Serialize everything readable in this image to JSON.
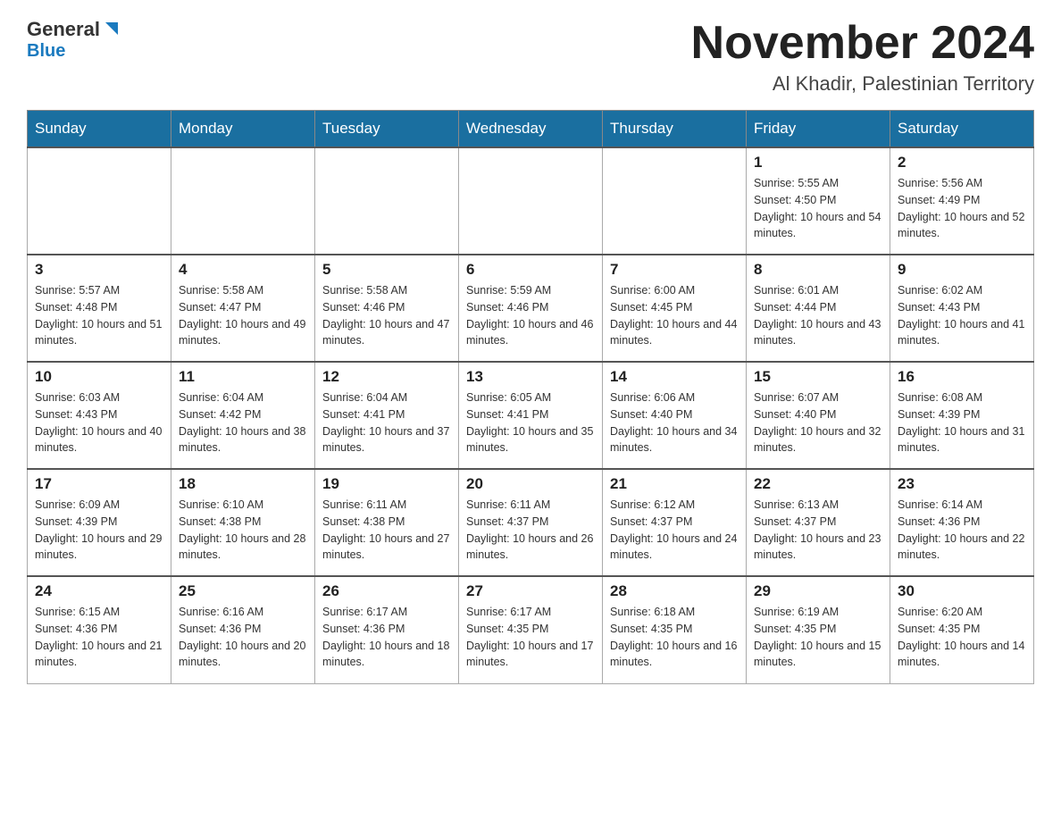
{
  "header": {
    "logo_general": "General",
    "logo_blue": "Blue",
    "title": "November 2024",
    "subtitle": "Al Khadir, Palestinian Territory"
  },
  "days_of_week": [
    "Sunday",
    "Monday",
    "Tuesday",
    "Wednesday",
    "Thursday",
    "Friday",
    "Saturday"
  ],
  "weeks": [
    {
      "days": [
        {
          "number": "",
          "empty": true
        },
        {
          "number": "",
          "empty": true
        },
        {
          "number": "",
          "empty": true
        },
        {
          "number": "",
          "empty": true
        },
        {
          "number": "",
          "empty": true
        },
        {
          "number": "1",
          "sunrise": "Sunrise: 5:55 AM",
          "sunset": "Sunset: 4:50 PM",
          "daylight": "Daylight: 10 hours and 54 minutes."
        },
        {
          "number": "2",
          "sunrise": "Sunrise: 5:56 AM",
          "sunset": "Sunset: 4:49 PM",
          "daylight": "Daylight: 10 hours and 52 minutes."
        }
      ]
    },
    {
      "days": [
        {
          "number": "3",
          "sunrise": "Sunrise: 5:57 AM",
          "sunset": "Sunset: 4:48 PM",
          "daylight": "Daylight: 10 hours and 51 minutes."
        },
        {
          "number": "4",
          "sunrise": "Sunrise: 5:58 AM",
          "sunset": "Sunset: 4:47 PM",
          "daylight": "Daylight: 10 hours and 49 minutes."
        },
        {
          "number": "5",
          "sunrise": "Sunrise: 5:58 AM",
          "sunset": "Sunset: 4:46 PM",
          "daylight": "Daylight: 10 hours and 47 minutes."
        },
        {
          "number": "6",
          "sunrise": "Sunrise: 5:59 AM",
          "sunset": "Sunset: 4:46 PM",
          "daylight": "Daylight: 10 hours and 46 minutes."
        },
        {
          "number": "7",
          "sunrise": "Sunrise: 6:00 AM",
          "sunset": "Sunset: 4:45 PM",
          "daylight": "Daylight: 10 hours and 44 minutes."
        },
        {
          "number": "8",
          "sunrise": "Sunrise: 6:01 AM",
          "sunset": "Sunset: 4:44 PM",
          "daylight": "Daylight: 10 hours and 43 minutes."
        },
        {
          "number": "9",
          "sunrise": "Sunrise: 6:02 AM",
          "sunset": "Sunset: 4:43 PM",
          "daylight": "Daylight: 10 hours and 41 minutes."
        }
      ]
    },
    {
      "days": [
        {
          "number": "10",
          "sunrise": "Sunrise: 6:03 AM",
          "sunset": "Sunset: 4:43 PM",
          "daylight": "Daylight: 10 hours and 40 minutes."
        },
        {
          "number": "11",
          "sunrise": "Sunrise: 6:04 AM",
          "sunset": "Sunset: 4:42 PM",
          "daylight": "Daylight: 10 hours and 38 minutes."
        },
        {
          "number": "12",
          "sunrise": "Sunrise: 6:04 AM",
          "sunset": "Sunset: 4:41 PM",
          "daylight": "Daylight: 10 hours and 37 minutes."
        },
        {
          "number": "13",
          "sunrise": "Sunrise: 6:05 AM",
          "sunset": "Sunset: 4:41 PM",
          "daylight": "Daylight: 10 hours and 35 minutes."
        },
        {
          "number": "14",
          "sunrise": "Sunrise: 6:06 AM",
          "sunset": "Sunset: 4:40 PM",
          "daylight": "Daylight: 10 hours and 34 minutes."
        },
        {
          "number": "15",
          "sunrise": "Sunrise: 6:07 AM",
          "sunset": "Sunset: 4:40 PM",
          "daylight": "Daylight: 10 hours and 32 minutes."
        },
        {
          "number": "16",
          "sunrise": "Sunrise: 6:08 AM",
          "sunset": "Sunset: 4:39 PM",
          "daylight": "Daylight: 10 hours and 31 minutes."
        }
      ]
    },
    {
      "days": [
        {
          "number": "17",
          "sunrise": "Sunrise: 6:09 AM",
          "sunset": "Sunset: 4:39 PM",
          "daylight": "Daylight: 10 hours and 29 minutes."
        },
        {
          "number": "18",
          "sunrise": "Sunrise: 6:10 AM",
          "sunset": "Sunset: 4:38 PM",
          "daylight": "Daylight: 10 hours and 28 minutes."
        },
        {
          "number": "19",
          "sunrise": "Sunrise: 6:11 AM",
          "sunset": "Sunset: 4:38 PM",
          "daylight": "Daylight: 10 hours and 27 minutes."
        },
        {
          "number": "20",
          "sunrise": "Sunrise: 6:11 AM",
          "sunset": "Sunset: 4:37 PM",
          "daylight": "Daylight: 10 hours and 26 minutes."
        },
        {
          "number": "21",
          "sunrise": "Sunrise: 6:12 AM",
          "sunset": "Sunset: 4:37 PM",
          "daylight": "Daylight: 10 hours and 24 minutes."
        },
        {
          "number": "22",
          "sunrise": "Sunrise: 6:13 AM",
          "sunset": "Sunset: 4:37 PM",
          "daylight": "Daylight: 10 hours and 23 minutes."
        },
        {
          "number": "23",
          "sunrise": "Sunrise: 6:14 AM",
          "sunset": "Sunset: 4:36 PM",
          "daylight": "Daylight: 10 hours and 22 minutes."
        }
      ]
    },
    {
      "days": [
        {
          "number": "24",
          "sunrise": "Sunrise: 6:15 AM",
          "sunset": "Sunset: 4:36 PM",
          "daylight": "Daylight: 10 hours and 21 minutes."
        },
        {
          "number": "25",
          "sunrise": "Sunrise: 6:16 AM",
          "sunset": "Sunset: 4:36 PM",
          "daylight": "Daylight: 10 hours and 20 minutes."
        },
        {
          "number": "26",
          "sunrise": "Sunrise: 6:17 AM",
          "sunset": "Sunset: 4:36 PM",
          "daylight": "Daylight: 10 hours and 18 minutes."
        },
        {
          "number": "27",
          "sunrise": "Sunrise: 6:17 AM",
          "sunset": "Sunset: 4:35 PM",
          "daylight": "Daylight: 10 hours and 17 minutes."
        },
        {
          "number": "28",
          "sunrise": "Sunrise: 6:18 AM",
          "sunset": "Sunset: 4:35 PM",
          "daylight": "Daylight: 10 hours and 16 minutes."
        },
        {
          "number": "29",
          "sunrise": "Sunrise: 6:19 AM",
          "sunset": "Sunset: 4:35 PM",
          "daylight": "Daylight: 10 hours and 15 minutes."
        },
        {
          "number": "30",
          "sunrise": "Sunrise: 6:20 AM",
          "sunset": "Sunset: 4:35 PM",
          "daylight": "Daylight: 10 hours and 14 minutes."
        }
      ]
    }
  ]
}
